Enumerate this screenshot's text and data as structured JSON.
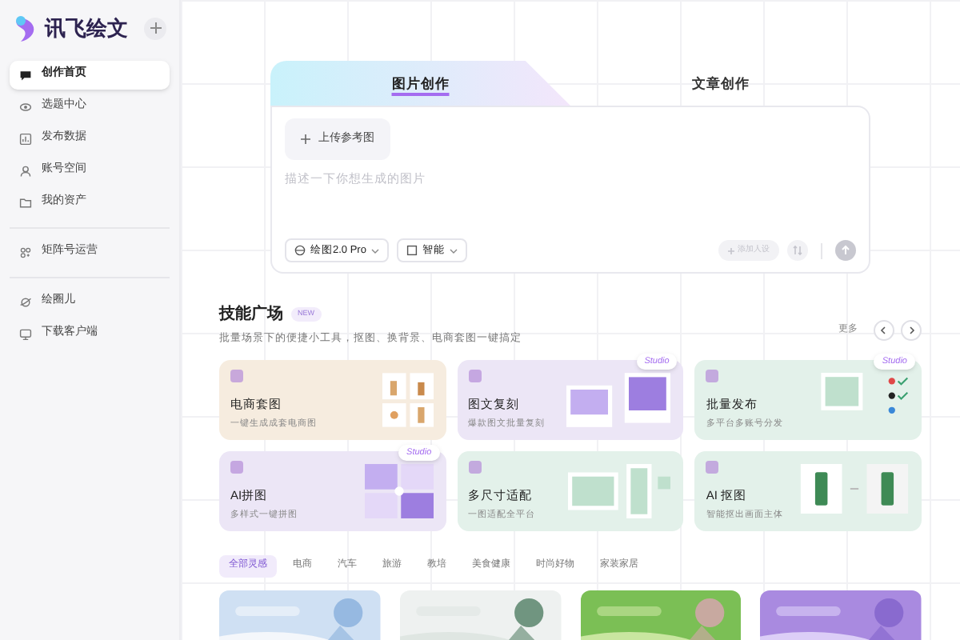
{
  "sidebar": {
    "brand": "讯飞绘文",
    "items": [
      {
        "label": "创作首页",
        "selected": true
      },
      {
        "label": "选题中心",
        "selected": false
      },
      {
        "label": "发布数据",
        "selected": false
      },
      {
        "label": "账号空间",
        "selected": false
      },
      {
        "label": "我的资产",
        "selected": false
      }
    ],
    "group2": [
      {
        "label": "矩阵号运营",
        "selected": false
      }
    ],
    "group3": [
      {
        "label": "绘圈儿",
        "selected": false
      },
      {
        "label": "下载客户端",
        "selected": false
      }
    ]
  },
  "composer": {
    "tabs": [
      {
        "label": "图片创作",
        "selected": true
      },
      {
        "label": "文章创作",
        "selected": false
      }
    ],
    "upload": "上传参考图",
    "placeholder": "描述一下你想生成的图片",
    "model": "绘图2.0 Pro",
    "ratio": "智能",
    "add_person": "添加人设"
  },
  "skills": {
    "title": "技能广场",
    "badge": "NEW",
    "subtitle": "批量场景下的便捷小工具，抠图、换背景、电商套图一键搞定",
    "more": "更多",
    "cards": [
      {
        "title": "电商套图",
        "desc": "一键生成成套电商图",
        "color": "#f6ecdf",
        "kind": "products"
      },
      {
        "title": "图文复刻",
        "desc": "爆款图文批量复刻",
        "color": "#ece6f6",
        "badge": "Studio",
        "kind": "copy"
      },
      {
        "title": "批量发布",
        "desc": "多平台多账号分发",
        "color": "#e3f1ea",
        "badge": "Studio",
        "kind": "publish"
      },
      {
        "title": "AI拼图",
        "desc": "多样式一键拼图",
        "color": "#ece6f6",
        "badge": "Studio",
        "kind": "collage"
      },
      {
        "title": "多尺寸适配",
        "desc": "一图适配全平台",
        "color": "#e3f1ea",
        "kind": "resize"
      },
      {
        "title": "AI 抠图",
        "desc": "智能抠出画面主体",
        "color": "#e3f1ea",
        "kind": "cutout"
      }
    ]
  },
  "filters": [
    {
      "label": "全部灵感",
      "selected": true
    },
    {
      "label": "电商",
      "selected": false
    },
    {
      "label": "汽车",
      "selected": false
    },
    {
      "label": "旅游",
      "selected": false
    },
    {
      "label": "教培",
      "selected": false
    },
    {
      "label": "美食健康",
      "selected": false
    },
    {
      "label": "时尚好物",
      "selected": false
    },
    {
      "label": "家装家居",
      "selected": false
    }
  ]
}
